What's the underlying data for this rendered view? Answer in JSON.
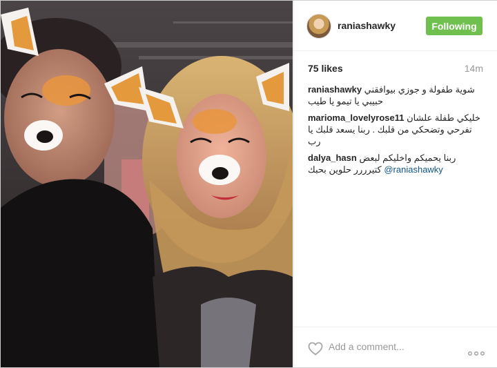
{
  "post": {
    "username": "raniashawky",
    "follow_label": "Following",
    "likes": "75 likes",
    "time": "14m"
  },
  "comments": [
    {
      "user": "raniashawky",
      "text": "شوية طفولة و جوزي بيوافقني حبيبي يا تيمو يا طيب"
    },
    {
      "user": "marioma_lovelyrose11",
      "text": "خليكي طفلة علشان تفرحي وتضحكي من قلبك . ربنا يسعد قلبك يا رب"
    },
    {
      "user": "dalya_hasn",
      "text": "ربنا يحميكم واخليكم لبعض كتيرررر حلوين بحبك",
      "mention": "@raniashawky"
    }
  ],
  "comment_box": {
    "placeholder": "Add a comment..."
  },
  "colors": {
    "follow_bg": "#70c050",
    "mention": "#125688"
  },
  "icons": [
    "heart-icon",
    "more-options-icon"
  ]
}
